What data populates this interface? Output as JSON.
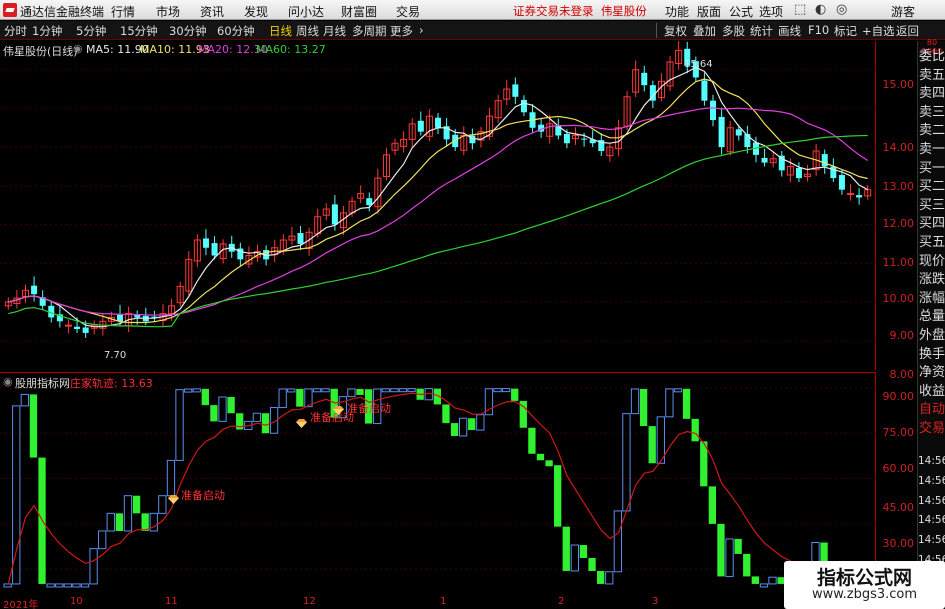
{
  "menubar": {
    "brand": "通达信金融终端",
    "items": [
      "行情",
      "市场",
      "资讯",
      "发现",
      "问小达",
      "财富圈",
      "交易"
    ],
    "warning": "证券交易未登录",
    "stock": "伟星股份",
    "right": [
      "功能",
      "版面",
      "公式",
      "选项"
    ],
    "guest": "游客"
  },
  "toolbar": {
    "periods": [
      "分时",
      "1分钟",
      "5分钟",
      "15分钟",
      "30分钟",
      "60分钟",
      "日线",
      "周线",
      "月线",
      "多周期",
      "更多"
    ],
    "active": "日线",
    "right": [
      "复权",
      "叠加",
      "多股",
      "统计",
      "画线",
      "F10",
      "标记",
      "+自选",
      "返回"
    ]
  },
  "main": {
    "title": "伟星股份(日线)",
    "ma": [
      {
        "label": "MA5: 11.90",
        "color": "#e8e8e8"
      },
      {
        "label": "MA10: 11.93",
        "color": "#f0e060"
      },
      {
        "label": "MA20: 12.30",
        "color": "#e040e0"
      },
      {
        "label": "MA60: 13.27",
        "color": "#30d030"
      }
    ],
    "high_label": "15.64",
    "low_label": "7.70",
    "y_ticks": [
      "15.00",
      "14.00",
      "13.00",
      "12.00",
      "11.00",
      "10.00",
      "9.00",
      "8.00"
    ]
  },
  "indicator": {
    "title": "股朋指标网",
    "line": "庄家轨迹: 13.63",
    "y_ticks": [
      "90.00",
      "75.00",
      "60.00",
      "45.00",
      "30.00"
    ],
    "signals": [
      "准备启动",
      "准备启动",
      "准备启动"
    ]
  },
  "time_axis": [
    "2021年",
    "10",
    "11",
    "12",
    "1",
    "2",
    "3"
  ],
  "side": {
    "top": "80 1000",
    "items": [
      "委比",
      "卖五",
      "卖四",
      "卖三",
      "卖二",
      "卖一",
      "买一",
      "买二",
      "买三",
      "买四",
      "买五",
      "现价",
      "涨跌",
      "涨幅",
      "总量",
      "外盘",
      "换手",
      "净资",
      "收益",
      "自动",
      "交易"
    ],
    "times": [
      "14:56",
      "14:56",
      "14:56",
      "14:56",
      "14:56",
      "14:56",
      "14:56",
      "14:56"
    ]
  },
  "watermark": {
    "title": "指标公式网",
    "url": "www.zbgs3.com"
  },
  "chart_data": [
    {
      "type": "candlestick",
      "title": "伟星股份(日线)",
      "series": [
        {
          "name": "MA5",
          "value": 11.9
        },
        {
          "name": "MA10",
          "value": 11.93
        },
        {
          "name": "MA20",
          "value": 12.3
        },
        {
          "name": "MA60",
          "value": 13.27
        }
      ],
      "close_approx": [
        9.0,
        9.1,
        9.3,
        9.2,
        8.9,
        8.6,
        8.5,
        8.4,
        8.3,
        8.2,
        8.4,
        8.5,
        8.6,
        8.5,
        8.7,
        8.6,
        8.5,
        8.6,
        8.7,
        8.9,
        9.4,
        10.1,
        10.6,
        10.4,
        10.2,
        10.5,
        10.3,
        10.1,
        10.2,
        10.3,
        10.1,
        10.4,
        10.6,
        10.7,
        10.5,
        10.8,
        11.2,
        11.4,
        11.0,
        11.3,
        11.6,
        11.8,
        11.5,
        12.2,
        12.8,
        13.1,
        13.2,
        13.6,
        13.4,
        13.8,
        13.5,
        13.2,
        13.0,
        13.3,
        13.1,
        13.4,
        13.8,
        14.2,
        14.5,
        14.3,
        13.9,
        13.5,
        13.4,
        13.6,
        13.3,
        13.1,
        13.3,
        13.2,
        13.1,
        12.9,
        13.0,
        13.5,
        14.3,
        15.0,
        14.6,
        14.2,
        14.7,
        15.2,
        15.5,
        15.1,
        14.8,
        14.2,
        13.7,
        13.0,
        13.5,
        13.3,
        13.0,
        12.8,
        12.6,
        12.7,
        12.4,
        12.5,
        12.2,
        12.3,
        12.9,
        12.5,
        12.2,
        11.9,
        11.8,
        11.7,
        11.9
      ],
      "high": 15.64,
      "low": 7.7,
      "ylim": [
        7.5,
        16.0
      ]
    },
    {
      "type": "line",
      "title": "股朋指标网",
      "series": [
        {
          "name": "庄家轨迹",
          "last": 13.63
        }
      ],
      "ylim": [
        20,
        95
      ]
    }
  ]
}
